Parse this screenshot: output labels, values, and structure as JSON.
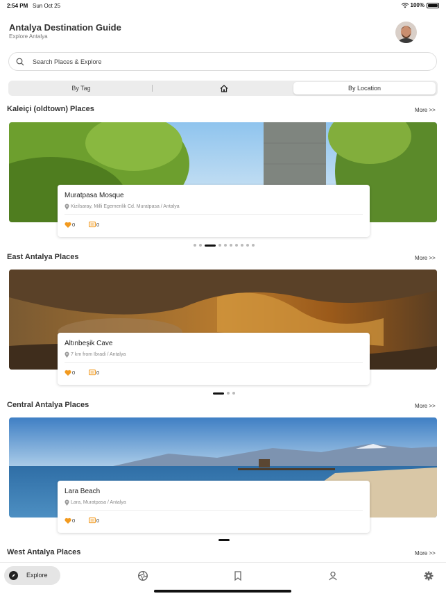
{
  "status_bar": {
    "time": "2:54 PM",
    "date": "Sun Oct 25",
    "battery": "100%"
  },
  "header": {
    "title": "Antalya Destination Guide",
    "subtitle": "Explore Antalya",
    "avatar_icon": "user-avatar"
  },
  "search": {
    "placeholder": "Search Places & Explore",
    "value": ""
  },
  "segmented": {
    "by_tag": "By Tag",
    "home_icon": "home-icon",
    "by_location": "By Location",
    "selected": "By Location"
  },
  "sections": [
    {
      "title": "Kaleiçi (oldtown) Places",
      "more": "More >>",
      "place": {
        "name": "Muratpasa Mosque",
        "location": "Kizilsaray, Milli Egemenlik Cd. Muratpasa / Antalya",
        "likes": "0",
        "comments": "0"
      },
      "page_count": 10,
      "active_page": 2
    },
    {
      "title": "East Antalya Places",
      "more": "More >>",
      "place": {
        "name": "Altınbeşik Cave",
        "location": "7 km from Ibradi / Antalya",
        "likes": "0",
        "comments": "0"
      },
      "page_count": 3,
      "active_page": 0
    },
    {
      "title": "Central Antalya Places",
      "more": "More >>",
      "place": {
        "name": "Lara Beach",
        "location": "Lara, Muratpasa / Antalya",
        "likes": "0",
        "comments": "0"
      },
      "page_count": 1,
      "active_page": 0
    },
    {
      "title": "West Antalya Places",
      "more": "More >>"
    }
  ],
  "tab_bar": {
    "explore": "Explore",
    "selected": "Explore"
  },
  "colors": {
    "accent": "#f29a1f",
    "text": "#333333",
    "tab_active_bg": "#e5e5e5"
  }
}
